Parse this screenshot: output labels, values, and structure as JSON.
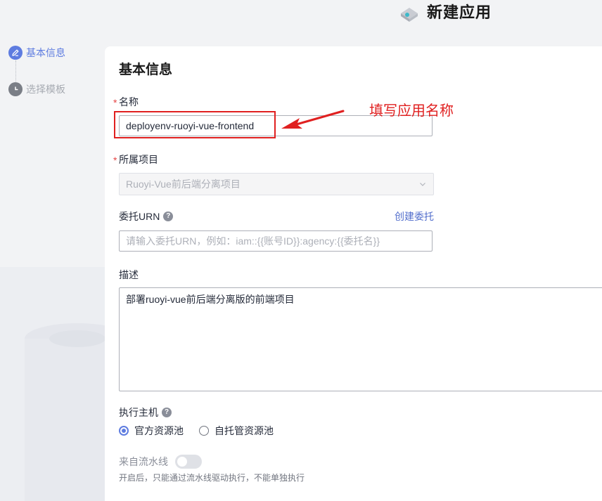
{
  "header": {
    "title": "新建应用"
  },
  "steps": [
    {
      "label": "基本信息",
      "state": "active",
      "icon": "pencil-icon"
    },
    {
      "label": "选择模板",
      "state": "inactive",
      "icon": "clock-icon"
    }
  ],
  "form": {
    "section_title": "基本信息",
    "required_mark": "*",
    "name": {
      "label": "名称",
      "value": "deployenv-ruoyi-vue-frontend"
    },
    "project": {
      "label": "所属项目",
      "value": "Ruoyi-Vue前后端分离项目"
    },
    "urn": {
      "label": "委托URN",
      "placeholder": "请输入委托URN，例如：iam::{{账号ID}}:agency:{{委托名}}",
      "link": "创建委托"
    },
    "description": {
      "label": "描述",
      "value": "部署ruoyi-vue前后端分离版的前端项目"
    },
    "host": {
      "label": "执行主机",
      "options": [
        {
          "label": "官方资源池",
          "checked": true
        },
        {
          "label": "自托管资源池",
          "checked": false
        }
      ]
    },
    "pipeline": {
      "label": "来自流水线",
      "enabled": false,
      "hint": "开启后，只能通过流水线驱动执行，不能单独执行"
    }
  },
  "annotation": {
    "text": "填写应用名称",
    "color": "#e02020"
  },
  "colors": {
    "accent": "#5e7ce0",
    "link": "#526ecc",
    "required": "#e54545"
  }
}
